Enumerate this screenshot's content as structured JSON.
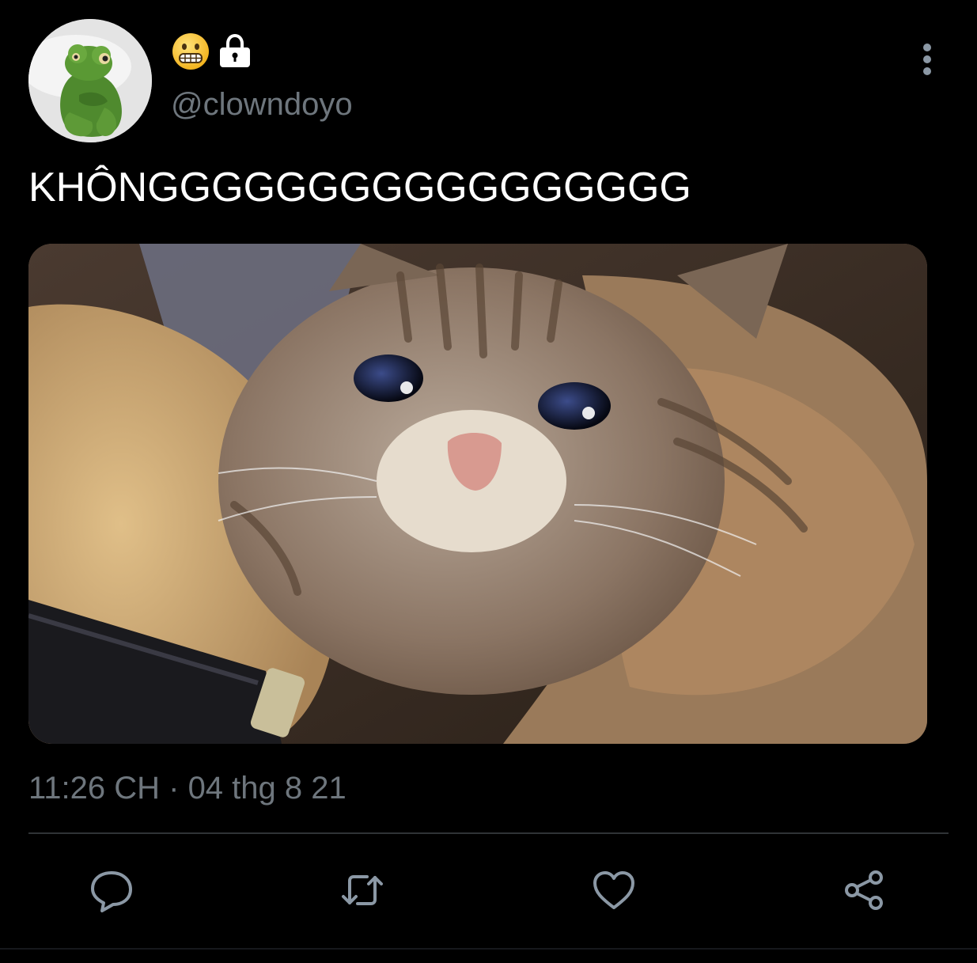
{
  "tweet": {
    "username": "@clowndoyo",
    "display_name_icons": [
      "grimacing-face-emoji",
      "lock-icon"
    ],
    "text": "KHÔNGGGGGGGGGGGGGGGGG",
    "timestamp": "11:26 CH · 04 thg 8 21",
    "media_description_icon": "crying-cat-photo",
    "avatar_icon": "green-plush-frog-avatar"
  },
  "actions": {
    "reply_icon": "reply-icon",
    "retweet_icon": "retweet-icon",
    "like_icon": "heart-icon",
    "share_icon": "share-icon"
  },
  "colors": {
    "background": "#000000",
    "primary_text": "#ffffff",
    "secondary_text": "#6e767d",
    "divider": "#2f3336",
    "icon": "#8b98a5"
  }
}
